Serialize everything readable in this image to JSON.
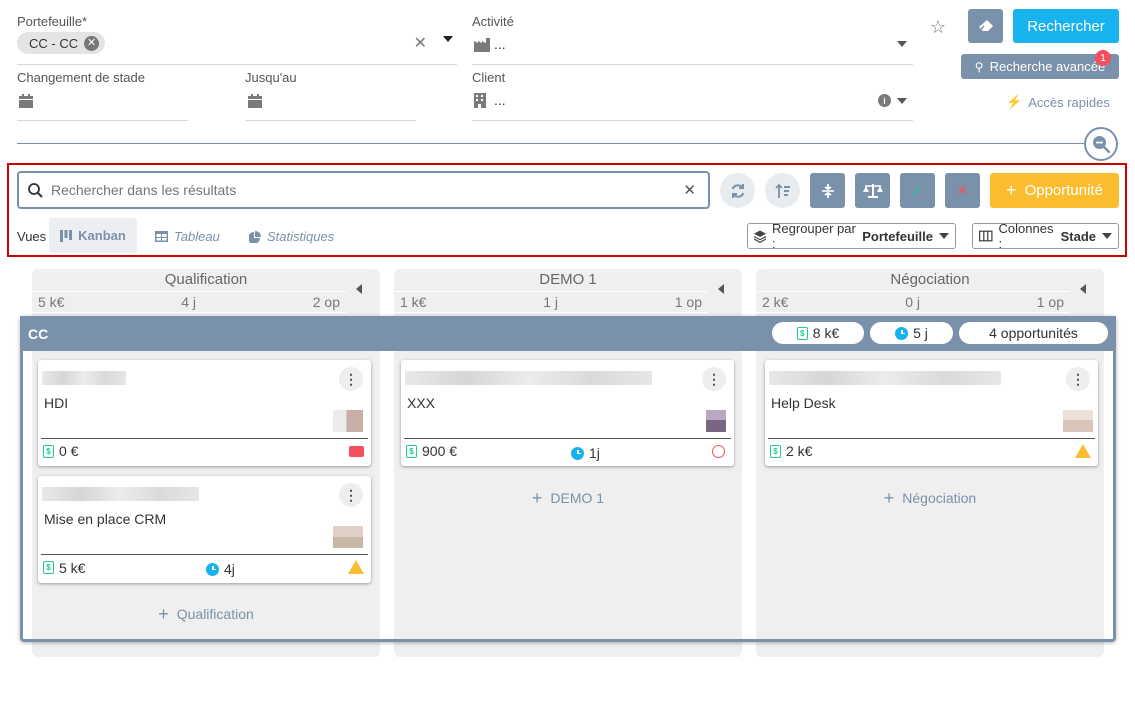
{
  "filters": {
    "portefeuille": {
      "label": "Portefeuille*",
      "chip": "CC - CC"
    },
    "activite": {
      "label": "Activité",
      "value": "..."
    },
    "changement_stade": {
      "label": "Changement de stade"
    },
    "jusqu_au": {
      "label": "Jusqu'au"
    },
    "client": {
      "label": "Client",
      "value": "..."
    }
  },
  "actions": {
    "search_label": "Rechercher",
    "advanced_label": "Recherche avancée",
    "advanced_badge": "1",
    "quick_access_label": "Accès rapides"
  },
  "toolbar": {
    "search_placeholder": "Rechercher dans les résultats",
    "new_opportunity_label": "Opportunité",
    "vues_label": "Vues",
    "views": [
      {
        "label": "Kanban",
        "active": true
      },
      {
        "label": "Tableau",
        "active": false
      },
      {
        "label": "Statistiques",
        "active": false
      }
    ],
    "group_by": {
      "label": "Regrouper par :",
      "value": "Portefeuille"
    },
    "columns": {
      "label": "Colonnes :",
      "value": "Stade"
    }
  },
  "board": {
    "columns": [
      {
        "title": "Qualification",
        "amount": "5 k€",
        "days": "4 j",
        "count": "2 op",
        "add_label": "Qualification"
      },
      {
        "title": "DEMO 1",
        "amount": "1 k€",
        "days": "1 j",
        "count": "1 op",
        "add_label": "DEMO 1"
      },
      {
        "title": "Négociation",
        "amount": "2 k€",
        "days": "0 j",
        "count": "1 op",
        "add_label": "Négociation"
      }
    ],
    "group": {
      "name": "CC",
      "amount": "8 k€",
      "days": "5 j",
      "count_label": "4 opportunités"
    },
    "cards": [
      {
        "title": "HDI",
        "amount": "0 €"
      },
      {
        "title": "Mise en place CRM",
        "amount": "5 k€",
        "days": "4j"
      },
      {
        "title": "XXX",
        "amount": "900 €",
        "days": "1j"
      },
      {
        "title": "Help Desk",
        "amount": "2 k€"
      }
    ]
  },
  "colors": {
    "accent_cyan": "#17b3ee",
    "slate": "#7a91ab",
    "orange": "#fbbd30",
    "highlight_red": "#cc0000",
    "money_green": "#20c997"
  }
}
